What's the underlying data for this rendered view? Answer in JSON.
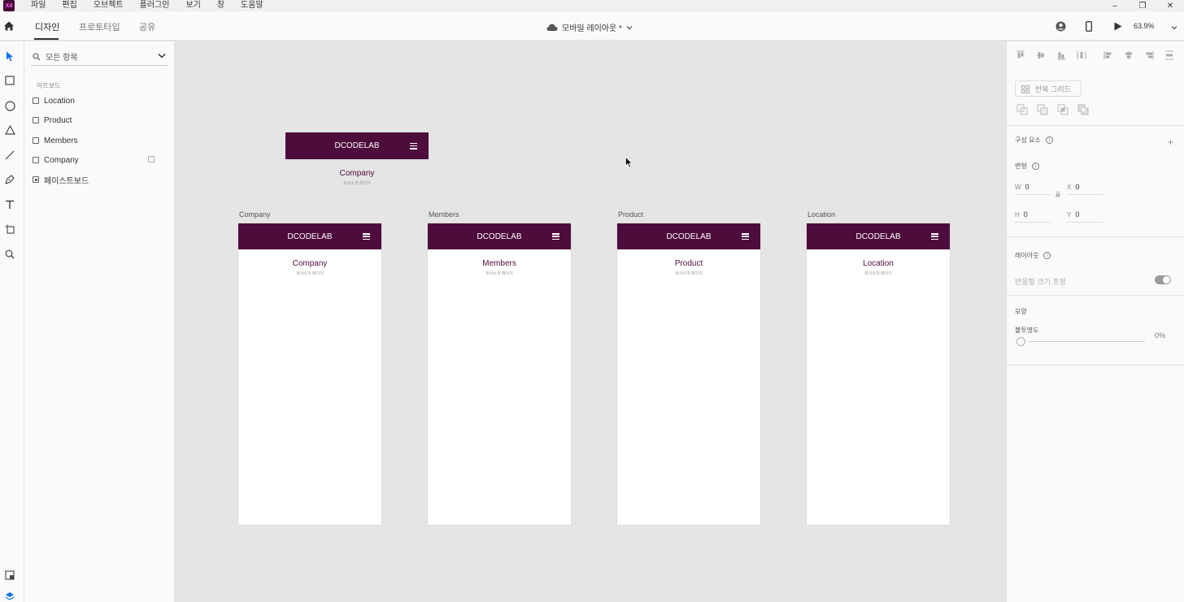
{
  "app": {
    "logo": "Xd"
  },
  "menu": [
    "파일",
    "편집",
    "오브젝트",
    "플러그인",
    "보기",
    "창",
    "도움말"
  ],
  "window_controls": {
    "minimize": "–",
    "restore": "❐",
    "close": "✕"
  },
  "toolbar": {
    "tabs": [
      "디자인",
      "프로토타입",
      "공유"
    ],
    "active_tab": "디자인",
    "document_title": "모바일 레이아웃 *",
    "zoom": "63.9%"
  },
  "layers": {
    "search_placeholder": "모든 항목",
    "section": "아트보드",
    "items": [
      "Location",
      "Product",
      "Members",
      "Company",
      "페이스트보드"
    ]
  },
  "canvas": {
    "standalone_header": {
      "brand": "DCODELAB",
      "title": "Company",
      "subtitle": "회사소개 페이지"
    },
    "artboards": [
      {
        "label": "Company",
        "brand": "DCODELAB",
        "title": "Company",
        "subtitle": "회사소개 페이지"
      },
      {
        "label": "Members",
        "brand": "DCODELAB",
        "title": "Members",
        "subtitle": "회사소개 페이지"
      },
      {
        "label": "Product",
        "brand": "DCODELAB",
        "title": "Product",
        "subtitle": "회사소개 페이지"
      },
      {
        "label": "Location",
        "brand": "DCODELAB",
        "title": "Location",
        "subtitle": "회사소개 페이지"
      }
    ]
  },
  "properties": {
    "repeat_grid": "반복 그리드",
    "components": "구성 요소",
    "add": "+",
    "transform": "변형",
    "w_label": "W",
    "w_value": "0",
    "h_label": "H",
    "h_value": "0",
    "x_label": "X",
    "x_value": "0",
    "y_label": "Y",
    "y_value": "0",
    "layout": "레이아웃",
    "responsive_resize": "반응형 크기 조정",
    "appearance": "모양",
    "opacity": "불투명도",
    "opacity_value": "0%"
  },
  "colors": {
    "brand": "#4e0c3c",
    "accent": "#1473e6"
  }
}
